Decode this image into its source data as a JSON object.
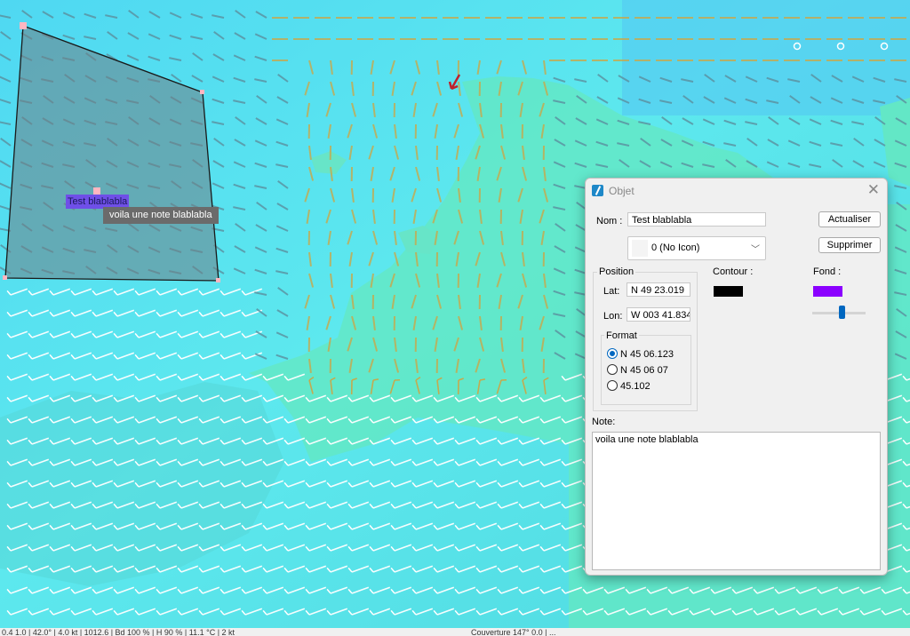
{
  "map": {
    "polygon_label": "Test blablabla",
    "polygon_note": "voila une note blablabla",
    "colors": {
      "sea": "#52e2f0",
      "land": "#5fe6c0",
      "polygon_fill": "#6f7f86"
    }
  },
  "status_bar": {
    "left": "0.4 1.0 | 42.0° | 4.0 kt | 1012.6 | Bd 100 % | H 90 % | 11.1 °C | 2 kt",
    "right": "Couverture 147° 0.0 | ..."
  },
  "dialog": {
    "title": "Objet",
    "close_icon": "close-x",
    "name_label": "Nom :",
    "name_value": "Test blablabla",
    "icon_select": "0 (No Icon)",
    "update_button": "Actualiser",
    "delete_button": "Supprimer",
    "position_group": "Position",
    "lat_label": "Lat:",
    "lat_value": "N 49 23.019",
    "lon_label": "Lon:",
    "lon_value": "W 003 41.834",
    "format_group": "Format",
    "format_options": [
      "N 45 06.123",
      "N 45 06 07",
      "45.102"
    ],
    "format_selected": 0,
    "contour_label": "Contour :",
    "contour_color": "#000000",
    "fill_label": "Fond :",
    "fill_color": "#8b00ff",
    "opacity": 0.55,
    "note_label": "Note:",
    "note_value": "voila une note blablabla"
  }
}
